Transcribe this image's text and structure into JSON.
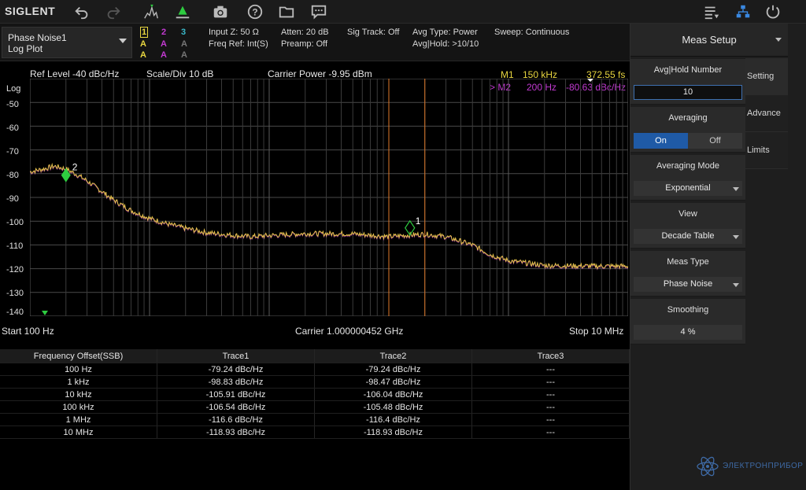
{
  "app": {
    "logo": "SIGLENT"
  },
  "toolbar": {
    "icons": [
      "undo-icon",
      "redo-icon",
      "marker-peak-icon",
      "marker-to-center-icon",
      "camera-icon",
      "help-icon",
      "folder-icon",
      "message-icon",
      "menu-list-icon",
      "network-icon",
      "power-icon"
    ]
  },
  "infobar": {
    "mode_line1": "Phase Noise1",
    "mode_line2": "Log Plot",
    "trace_nums": [
      "1",
      "2",
      "3"
    ],
    "trace_modes_row1": [
      "A",
      "A",
      "A"
    ],
    "trace_modes_row2": [
      "A",
      "A",
      "A"
    ],
    "input_z": "Input Z: 50 Ω",
    "freq_ref": "Freq Ref: Int(S)",
    "atten": "Atten: 20 dB",
    "preamp": "Preamp: Off",
    "sig_track": "Sig Track: Off",
    "avg_type": "Avg Type: Power",
    "avg_hold": "Avg|Hold: >10/10",
    "sweep": "Sweep: Continuous"
  },
  "plot_header": {
    "ref_level": "Ref Level  -40 dBc/Hz",
    "scale_div": "Scale/Div  10 dB",
    "carrier_power": "Carrier Power  -9.95 dBm",
    "m1_label": "M1",
    "m1_freq": "150 kHz",
    "m1_value": "372.55 fs",
    "m2_label": "> M2",
    "m2_freq": "200 Hz",
    "m2_value": "-80.63 dBc/Hz"
  },
  "plot": {
    "scale_label": "Log",
    "y_ticks": [
      "-50",
      "-60",
      "-70",
      "-80",
      "-90",
      "-100",
      "-110",
      "-120",
      "-130",
      "-140"
    ],
    "marker1_label": "1",
    "marker2_label": "2",
    "trace_color": "#e8c64a",
    "marker_color": "#2ecc40"
  },
  "chart_data": {
    "type": "line",
    "xscale": "log",
    "xlim": [
      100,
      10000000
    ],
    "ylim": [
      -140,
      -40
    ],
    "ylabel": "Log",
    "series": [
      {
        "x": [
          100,
          130,
          160,
          200,
          250,
          300,
          400,
          500,
          700,
          1000,
          1500,
          2000,
          3000,
          5000,
          7000,
          10000,
          20000,
          50000,
          100000,
          150000,
          200000,
          300000,
          500000,
          700000,
          1000000,
          2000000,
          5000000,
          10000000
        ],
        "y": [
          -79.2,
          -78.0,
          -76.8,
          -78.0,
          -80.5,
          -83.0,
          -87.5,
          -91.0,
          -95.5,
          -98.8,
          -101.5,
          -103.0,
          -104.8,
          -105.9,
          -106.5,
          -106.0,
          -105.2,
          -105.3,
          -106.5,
          -105.8,
          -105.4,
          -106.5,
          -110.0,
          -114.0,
          -116.6,
          -118.6,
          -118.9,
          -118.9
        ]
      }
    ],
    "markers": [
      {
        "name": "M1",
        "x": 150000,
        "y": -105.5
      },
      {
        "name": "M2",
        "x": 200,
        "y": -80.63
      }
    ],
    "grid": true
  },
  "freq_row": {
    "start": "Start  100 Hz",
    "carrier": "Carrier  1.000000452 GHz",
    "stop": "Stop  10 MHz"
  },
  "table": {
    "headers": [
      "Frequency Offset(SSB)",
      "Trace1",
      "Trace2",
      "Trace3"
    ],
    "rows": [
      [
        "100 Hz",
        "-79.24 dBc/Hz",
        "-79.24 dBc/Hz",
        "---"
      ],
      [
        "1 kHz",
        "-98.83 dBc/Hz",
        "-98.47 dBc/Hz",
        "---"
      ],
      [
        "10 kHz",
        "-105.91 dBc/Hz",
        "-106.04 dBc/Hz",
        "---"
      ],
      [
        "100 kHz",
        "-106.54 dBc/Hz",
        "-105.48 dBc/Hz",
        "---"
      ],
      [
        "1 MHz",
        "-116.6 dBc/Hz",
        "-116.4 dBc/Hz",
        "---"
      ],
      [
        "10 MHz",
        "-118.93 dBc/Hz",
        "-118.93 dBc/Hz",
        "---"
      ]
    ]
  },
  "panel": {
    "title": "Meas Setup",
    "tabs": [
      "Setting",
      "Advance",
      "Limits"
    ],
    "avg_hold_label": "Avg|Hold Number",
    "avg_hold_value": "10",
    "averaging_label": "Averaging",
    "averaging_on": "On",
    "averaging_off": "Off",
    "avg_mode_label": "Averaging Mode",
    "avg_mode_value": "Exponential",
    "view_label": "View",
    "view_value": "Decade Table",
    "meas_type_label": "Meas Type",
    "meas_type_value": "Phase Noise",
    "smoothing_label": "Smoothing",
    "smoothing_value": "4 %"
  },
  "watermark": {
    "text": "ЭЛЕКТРОНПРИБОР"
  }
}
